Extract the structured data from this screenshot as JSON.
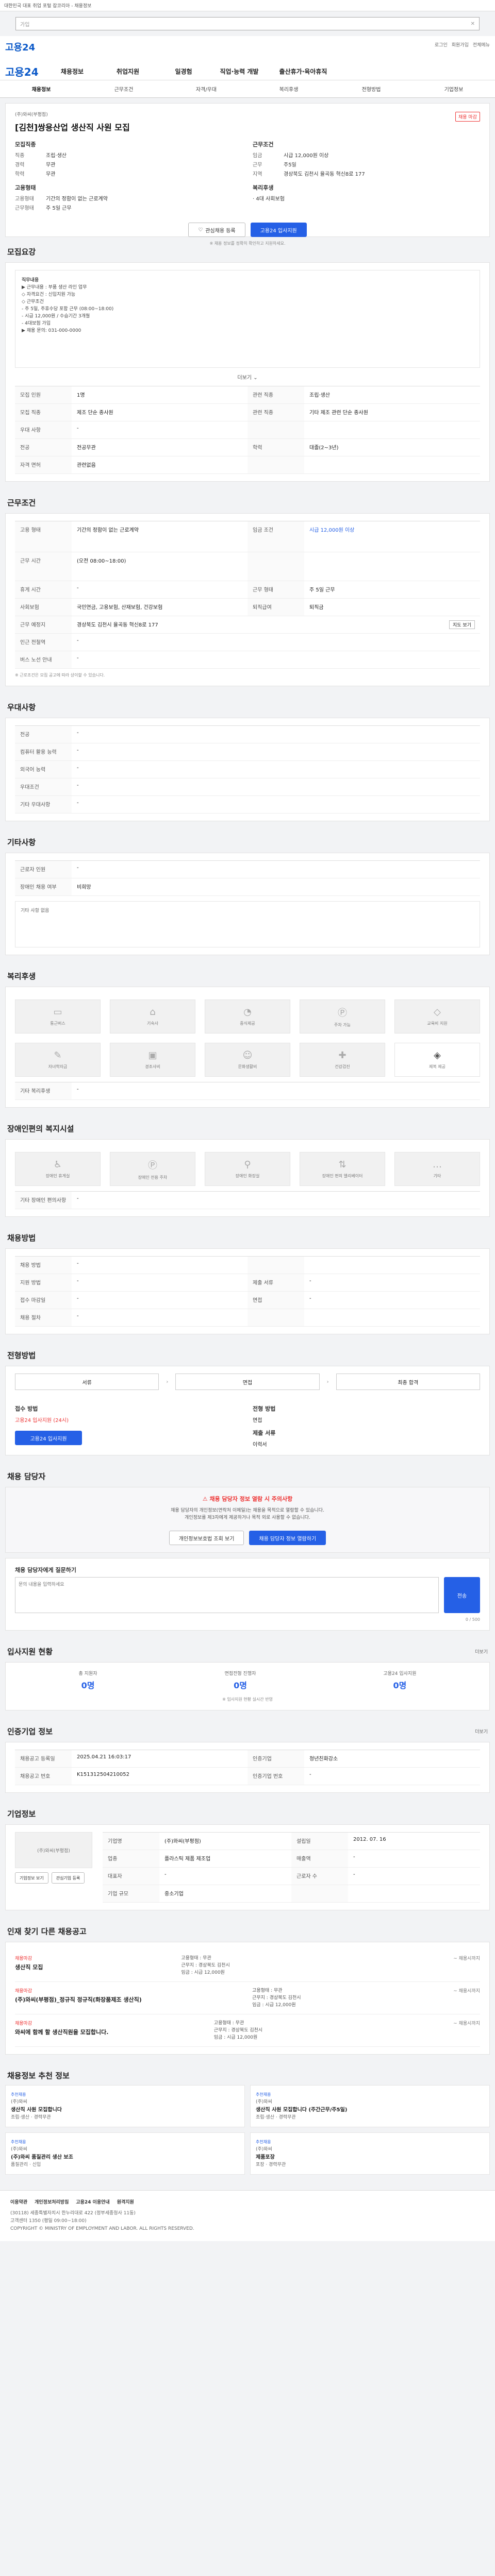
{
  "browser": {
    "banner": "대한민국 대표 취업 포털 잡코리아 - 채용정보",
    "search_placeholder": "가입",
    "close": "✕"
  },
  "header": {
    "logo": "고용24",
    "util": [
      "로그인",
      "회원가입",
      "전체메뉴"
    ]
  },
  "nav": {
    "logo": "고용24",
    "items": [
      "채용정보",
      "취업지원",
      "일경험",
      "직업·능력 개발",
      "출산휴가·육아휴직"
    ]
  },
  "tabs": [
    "채용정보",
    "근무조건",
    "자격/우대",
    "복리후생",
    "전형방법",
    "기업정보"
  ],
  "job": {
    "company": "(주)와씨(부평점)",
    "title": "[김천]쌍용산업 생산직 사원 모집",
    "badge": "채용 마감",
    "left_label": "모집직종",
    "left": [
      {
        "k": "직종",
        "v": "조립·생산"
      },
      {
        "k": "경력",
        "v": "무관"
      },
      {
        "k": "학력",
        "v": "무관"
      }
    ],
    "right_label": "근무조건",
    "right": [
      {
        "k": "임금",
        "v": "시급 12,000원 이상"
      },
      {
        "k": "근무",
        "v": "주5일"
      },
      {
        "k": "지역",
        "v": "경상북도 김천시 율곡동 혁신8로 177"
      }
    ],
    "left_label2": "고용형태",
    "left2": [
      {
        "k": "고용형태",
        "v": "기간의 정함이 없는 근로계약"
      },
      {
        "k": "근무형태",
        "v": "주 5일 근무"
      }
    ],
    "right_label2": "복리후생",
    "right2": [
      {
        "k": "",
        "v": "· 4대 사회보험"
      }
    ],
    "btn_fav": "관심채용 등록",
    "btn_apply": "고용24 입사지원",
    "notice": "※ 채용 정보를 정확히 확인하고 지원하세요."
  },
  "recruit": {
    "title": "모집요강",
    "desc_lines": [
      "직무내용",
      "▶ 근무내용 : 부품 생산 라인 업무",
      "",
      "◇ 자격요건 : 신입지원 가능",
      "◇ 근무조건",
      "- 주 5일, 주휴수당 포함 근무 (08:00~18:00)",
      "- 시급 12,000원 / 수습기간 3개월",
      "- 4대보험 가입",
      "",
      "▶ 채용 문의: 031-000-0000"
    ],
    "more": "더보기",
    "rows": [
      {
        "k1": "모집 인원",
        "v1": "1명",
        "k2": "관련 직종",
        "v2": "조립·생산"
      },
      {
        "k1": "모집 직종",
        "v1": "제조 단순 종사원",
        "k2": "관련 직종",
        "v2": "기타 제조 관련 단순 종사원"
      },
      {
        "k1": "우대 사항",
        "v1": "-",
        "k2": "",
        "v2": ""
      },
      {
        "k1": "전공",
        "v1": "전공무관",
        "k2": "학력",
        "v2": "대졸(2~3년)"
      },
      {
        "k1": "자격 면허",
        "v1": "관련없음",
        "k2": "",
        "v2": ""
      }
    ]
  },
  "work": {
    "title": "근무조건",
    "rows": [
      {
        "k1": "고용 형태",
        "v1": "기간의 정함이 없는 근로계약",
        "k2": "임금 조건",
        "v2": "시급 12,000원 이상"
      },
      {
        "k1": "근무 시간",
        "v1": "(오전 08:00~18:00)",
        "k2": "",
        "v2": ""
      },
      {
        "k1": "휴게 시간",
        "v1": "-",
        "k2": "근무 형태",
        "v2": "주 5일 근무"
      },
      {
        "k1": "사회보험",
        "v1": "국민연금, 고용보험, 산재보험, 건강보험",
        "k2": "퇴직급여",
        "v2": "퇴직금"
      },
      {
        "k1": "근무 예정지",
        "v1": "경상북도 김천시 율곡동 혁신8로 177",
        "k2": "",
        "v2": ""
      },
      {
        "k1": "인근 전철역",
        "v1": "-",
        "k2": "",
        "v2": ""
      },
      {
        "k1": "버스 노선 안내",
        "v1": "-",
        "k2": "",
        "v2": ""
      }
    ],
    "map_btn": "지도 보기",
    "note": "※ 근로조건은 모집 공고에 따라 상이할 수 있습니다."
  },
  "prefer": {
    "title": "우대사항",
    "rows": [
      {
        "k": "전공",
        "v": "-"
      },
      {
        "k": "컴퓨터 활용 능력",
        "v": "-"
      },
      {
        "k": "외국어 능력",
        "v": "-"
      },
      {
        "k": "우대조건",
        "v": "-"
      },
      {
        "k": "기타 우대사항",
        "v": "-"
      }
    ]
  },
  "etc": {
    "title": "기타사항",
    "rows": [
      {
        "k": "근로자 인원",
        "v": "-"
      },
      {
        "k": "장애인 채용 여부",
        "v": "비희망"
      }
    ],
    "empty": "기타 사항 없음"
  },
  "welfare": {
    "title": "복리후생",
    "items": [
      "통근버스",
      "기숙사",
      "중식제공",
      "주차 가능",
      "교육비 지원",
      "자녀학자금",
      "경조사비",
      "문화생활비",
      "건강검진",
      "제복 제공"
    ],
    "etc_label": "기타 복리후생",
    "etc_value": "-"
  },
  "disabled": {
    "title": "장애인편의 복지시설",
    "items": [
      "장애인 휴게실",
      "장애인 전용 주차",
      "장애인 화장실",
      "장애인 편의 엘리베이터",
      "기타"
    ],
    "etc_label": "기타 장애인 편의사항",
    "etc_value": "-"
  },
  "method": {
    "title": "채용방법",
    "rows": [
      {
        "k1": "채용 방법",
        "v1": "-",
        "k2": "",
        "v2": ""
      },
      {
        "k1": "지원 방법",
        "v1": "-",
        "k2": "제출 서류",
        "v2": "-"
      },
      {
        "k1": "접수 마감일",
        "v1": "-",
        "k2": "면접",
        "v2": "-"
      },
      {
        "k1": "채용 절차",
        "v1": "-",
        "k2": "",
        "v2": ""
      }
    ]
  },
  "process": {
    "title": "전형방법",
    "steps": [
      "서류",
      "면접",
      "최종 합격"
    ],
    "apply_label": "접수 방법",
    "apply_value": "고용24 입사지원 (24시)",
    "type_label": "전형 방법",
    "type_value": "면접",
    "doc_label": "제출 서류",
    "doc_value": "이력서",
    "btn": "고용24 입사지원"
  },
  "manager": {
    "title": "채용 담당자",
    "alert": "채용 담당자 정보 열람 시 주의사항",
    "lines": [
      "채용 담당자의 개인정보(연락처 이메일)는 채용을 목적으로 열람할 수 있습니다.",
      "개인정보를 제3자에게 제공하거나 목적 외로 사용할 수 없습니다."
    ],
    "btn1": "개인정보보호법 조회 보기",
    "btn2": "채용 담당자 정보 열람하기"
  },
  "inquiry": {
    "title": "채용 담당자에게 질문하기",
    "placeholder": "문의 내용을 입력하세요",
    "btn": "전송",
    "count": "0 / 500"
  },
  "process_status": {
    "title": "입사지원 현황",
    "more": "더보기",
    "cols": [
      {
        "k": "총 지원자",
        "v": "0명"
      },
      {
        "k": "면접전형 진행자",
        "v": "0명"
      },
      {
        "k": "고용24 입사지원",
        "v": "0명"
      }
    ],
    "note": "※ 입사지원 현황 실시간 반영"
  },
  "info": {
    "title": "인증기업 정보",
    "rows": [
      {
        "k1": "채용공고 등록일",
        "v1": "2025.04.21 16:03:17",
        "k2": "인증기업",
        "v2": "청년친화강소"
      },
      {
        "k1": "채용공고 번호",
        "v1": "K151312504210052",
        "k2": "인증기업 번호",
        "v2": "-"
      }
    ],
    "more": "더보기"
  },
  "company": {
    "title": "기업정보",
    "name": "(주)와씨(부평점)",
    "rows": [
      {
        "k1": "기업명",
        "v1": "(주)와씨(부평점)",
        "k2": "설립일",
        "v2": "2012. 07. 16"
      },
      {
        "k1": "업종",
        "v1": "플라스틱 제품 제조업",
        "k2": "매출액",
        "v2": "-"
      },
      {
        "k1": "대표자",
        "v1": "-",
        "k2": "근로자 수",
        "v2": "-"
      },
      {
        "k1": "기업 규모",
        "v1": "중소기업",
        "k2": "",
        "v2": ""
      }
    ],
    "btn1": "기업정보 보기",
    "btn2": "관심기업 등록"
  },
  "related": {
    "title": "인재 찾기 다른 채용공고",
    "items": [
      {
        "badge": "채용마감",
        "title": "생산직 모집",
        "info": [
          "고용형태 : 무관",
          "근무지 : 경상북도 김천시",
          "임금 : 시급 12,000원"
        ],
        "date": "~ 채용시까지"
      },
      {
        "badge": "채용마감",
        "title": "(주)와씨(부평점)_정규직 정규직(화장품제조 생산직)",
        "info": [
          "고용형태 : 무관",
          "근무지 : 경상북도 김천시",
          "임금 : 시급 12,000원"
        ],
        "date": "~ 채용시까지"
      },
      {
        "badge": "채용마감",
        "title": "와씨에 함께 할 생산직원을 모집합니다.",
        "info": [
          "고용형태 : 무관",
          "근무지 : 경상북도 김천시",
          "임금 : 시급 12,000원"
        ],
        "date": "~ 채용시까지"
      }
    ]
  },
  "more_jobs": {
    "title": "채용정보 추천 정보",
    "cards": [
      {
        "tag": "추천채용",
        "company": "(주)와씨",
        "title": "생산직 사원 모집합니다",
        "meta": [
          "조립·생산",
          "경력무관"
        ]
      },
      {
        "tag": "추천채용",
        "company": "(주)와씨",
        "title": "생산직 사원 모집합니다 (주간근무/주5일)",
        "meta": [
          "조립·생산",
          "경력무관"
        ]
      },
      {
        "tag": "추천채용",
        "company": "(주)와씨",
        "title": "(주)와씨 품질관리 생산 보조",
        "meta": [
          "품질관리",
          "신입"
        ]
      },
      {
        "tag": "추천채용",
        "company": "(주)와씨",
        "title": "제품포장",
        "meta": [
          "포장",
          "경력무관"
        ]
      }
    ]
  },
  "footer": {
    "links": [
      "이용약관",
      "개인정보처리방침",
      "고용24 이용안내",
      "원격지원"
    ],
    "lines": [
      "(30118) 세종특별자치시 한누리대로 422 (정부세종청사 11동)",
      "고객센터 1350 (평일 09:00~18:00)",
      "COPYRIGHT © MINISTRY OF EMPLOYMENT AND LABOR. ALL RIGHTS RESERVED."
    ]
  },
  "colors": {
    "accent": "#2560e6",
    "brand": "#0a58c8",
    "alert": "#e33333"
  }
}
